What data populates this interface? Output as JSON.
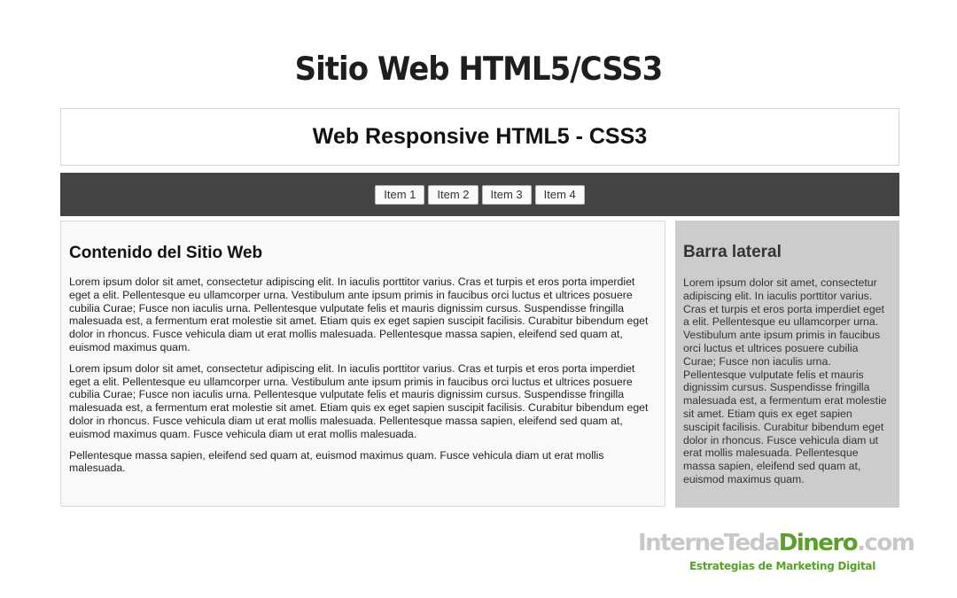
{
  "page": {
    "title": "Sitio Web HTML5/CSS3"
  },
  "header": {
    "title": "Web Responsive HTML5 - CSS3"
  },
  "nav": {
    "items": [
      {
        "label": "Item 1"
      },
      {
        "label": "Item 2"
      },
      {
        "label": "Item 3"
      },
      {
        "label": "Item 4"
      }
    ]
  },
  "main": {
    "heading": "Contenido del Sitio Web",
    "paragraphs": [
      "Lorem ipsum dolor sit amet, consectetur adipiscing elit. In iaculis porttitor varius. Cras et turpis et eros porta imperdiet eget a elit. Pellentesque eu ullamcorper urna. Vestibulum ante ipsum primis in faucibus orci luctus et ultrices posuere cubilia Curae; Fusce non iaculis urna. Pellentesque vulputate felis et mauris dignissim cursus. Suspendisse fringilla malesuada est, a fermentum erat molestie sit amet. Etiam quis ex eget sapien suscipit facilisis. Curabitur bibendum eget dolor in rhoncus. Fusce vehicula diam ut erat mollis malesuada. Pellentesque massa sapien, eleifend sed quam at, euismod maximus quam.",
      "Lorem ipsum dolor sit amet, consectetur adipiscing elit. In iaculis porttitor varius. Cras et turpis et eros porta imperdiet eget a elit. Pellentesque eu ullamcorper urna. Vestibulum ante ipsum primis in faucibus orci luctus et ultrices posuere cubilia Curae; Fusce non iaculis urna. Pellentesque vulputate felis et mauris dignissim cursus. Suspendisse fringilla malesuada est, a fermentum erat molestie sit amet. Etiam quis ex eget sapien suscipit facilisis. Curabitur bibendum eget dolor in rhoncus. Fusce vehicula diam ut erat mollis malesuada. Pellentesque massa sapien, eleifend sed quam at, euismod maximus quam. Fusce vehicula diam ut erat mollis malesuada.",
      "Pellentesque massa sapien, eleifend sed quam at, euismod maximus quam. Fusce vehicula diam ut erat mollis malesuada."
    ]
  },
  "sidebar": {
    "heading": "Barra lateral",
    "text": "Lorem ipsum dolor sit amet, consectetur adipiscing elit. In iaculis porttitor varius. Cras et turpis et eros porta imperdiet eget a elit. Pellentesque eu ullamcorper urna. Vestibulum ante ipsum primis in faucibus orci luctus et ultrices posuere cubilia Curae; Fusce non iaculis urna. Pellentesque vulputate felis et mauris dignissim cursus. Suspendisse fringilla malesuada est, a fermentum erat molestie sit amet. Etiam quis ex eget sapien suscipit facilisis. Curabitur bibendum eget dolor in rhoncus. Fusce vehicula diam ut erat mollis malesuada. Pellentesque massa sapien, eleifend sed quam at, euismod maximus quam."
  },
  "logo": {
    "part1": "InterneTeda",
    "part2": "Dinero",
    "part3": ".com",
    "tagline": "Estrategias de Marketing Digital"
  },
  "colors": {
    "navbar": "#444444",
    "sidebar": "#cccccc",
    "logo_green": "#5ba02a",
    "logo_gray": "#c8c8c8"
  }
}
